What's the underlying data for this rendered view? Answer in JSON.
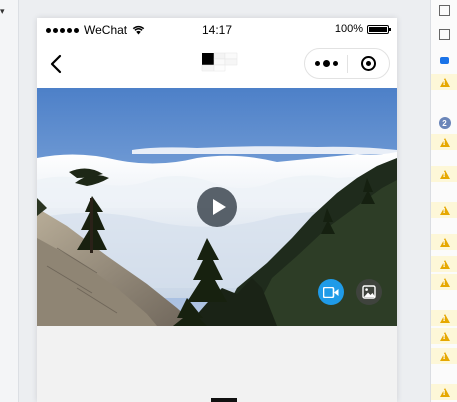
{
  "status_bar": {
    "carrier": "WeChat",
    "time": "14:17",
    "battery": "100%"
  },
  "nav": {
    "back_icon": "chevron-left-icon",
    "logo_icon": "pixel-logo-icon",
    "capsule_more_icon": "more-dots-icon",
    "capsule_close_icon": "target-circle-icon"
  },
  "media": {
    "image_description_icon": "landscape-photo",
    "play_icon": "play-icon",
    "video_tab_icon": "video-camera-icon",
    "image_tab_icon": "image-icon",
    "active_tab": "video"
  },
  "side_panel": {
    "badge_count": "2"
  },
  "colors": {
    "accent_blue": "#1f9be8",
    "warning": "#e6a800",
    "content_bg": "#f2f2f2"
  }
}
